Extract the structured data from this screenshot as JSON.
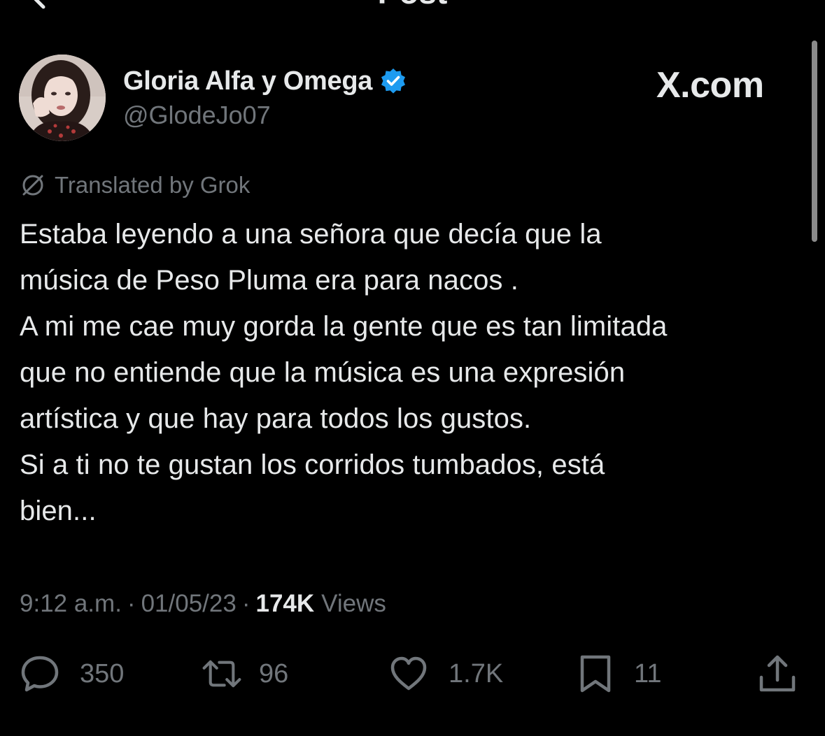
{
  "header": {
    "title": "Post"
  },
  "author": {
    "display_name": "Gloria Alfa y Omega",
    "handle": "@GlodeJo07",
    "verified": true
  },
  "watermark": "X.com",
  "translation": {
    "label": "Translated by Grok"
  },
  "post": {
    "lines": [
      "Estaba leyendo a una señora que decía que la",
      "música de Peso Pluma era para nacos .",
      "A mi me cae muy gorda la gente que es tan limitada",
      "que no entiende que la música es una expresión",
      "artística y que hay para todos los gustos.",
      "Si a ti no te gustan los corridos tumbados, está",
      "bien..."
    ]
  },
  "meta": {
    "time": "9:12 a.m.",
    "separator": "·",
    "date": "01/05/23",
    "views_count": "174K",
    "views_label": "Views"
  },
  "actions": {
    "replies": "350",
    "reposts": "96",
    "likes": "1.7K",
    "bookmarks": "11"
  },
  "colors": {
    "background": "#000000",
    "text_primary": "#e7e9ea",
    "text_secondary": "#71767b",
    "verified_badge": "#1d9bf0"
  },
  "icons": {
    "back": "chevron-left-icon",
    "verified": "verified-badge-icon",
    "translate": "grok-slash-icon",
    "reply": "reply-bubble-icon",
    "repost": "repost-icon",
    "like": "heart-icon",
    "bookmark": "bookmark-icon",
    "share": "share-icon"
  }
}
